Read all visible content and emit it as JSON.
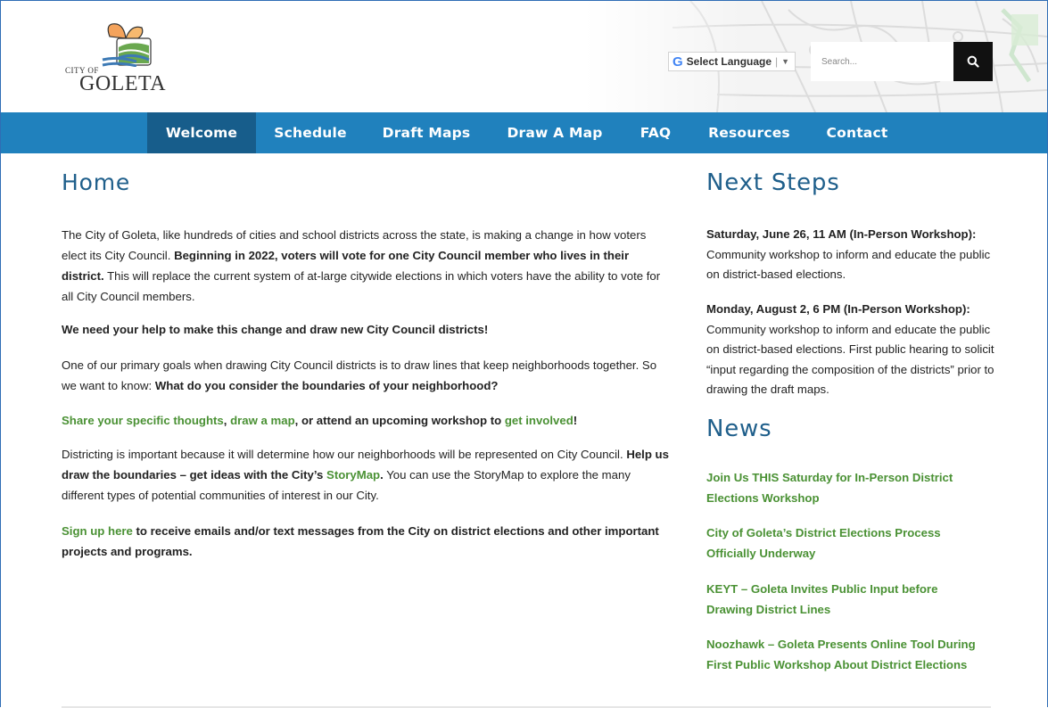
{
  "header": {
    "logo_city_of": "CITY OF",
    "logo_name": "GOLETA",
    "translate_label": "Select Language",
    "translate_g": "G",
    "translate_arrow": "▼",
    "search_placeholder": "Search...",
    "search_icon": "search-icon"
  },
  "nav": {
    "items": [
      {
        "label": "Welcome",
        "active": true
      },
      {
        "label": "Schedule"
      },
      {
        "label": "Draft Maps"
      },
      {
        "label": "Draw A Map"
      },
      {
        "label": "FAQ"
      },
      {
        "label": "Resources"
      },
      {
        "label": "Contact"
      }
    ]
  },
  "main": {
    "title": "Home",
    "p1_a": "The City of Goleta, like hundreds of cities and school districts across the state, is making a change in how voters elect its City Council. ",
    "p1_b": "Beginning in 2022, voters will vote for one City Council member who lives in their district.",
    "p1_c": " This will replace the current system of at-large citywide elections in which voters have the ability to vote for all City Council members.",
    "p2": "We need your help to make this change and draw new City Council districts!",
    "p3_a": "One of our primary goals when drawing City Council districts is to draw lines that keep neighborhoods together. So we want to know: ",
    "p3_b": "What do you consider the boundaries of your neighborhood?",
    "p4_link1": "Share your specific thoughts",
    "p4_sep1": ", ",
    "p4_link2": "draw a map",
    "p4_mid": ", or attend an upcoming workshop to ",
    "p4_link3": "get involved",
    "p4_end": "!",
    "p5_a": "Districting is important because it will determine how our neighborhoods will be represented on City Council. ",
    "p5_b": "Help us draw the boundaries – get ideas with the City’s ",
    "p5_link": "StoryMap",
    "p5_c": ".",
    "p5_d": " You can use the StoryMap to explore the many different types of potential communities of interest in our City.",
    "p6_link": "Sign up here",
    "p6_rest": " to receive emails and/or text messages from the City on district elections and other important projects and programs."
  },
  "sidebar": {
    "next_steps_title": "Next Steps",
    "events": [
      {
        "title": "Saturday, June 26, 11 AM (In-Person Workshop):",
        "desc": "Community workshop to inform and educate the public on district-based elections."
      },
      {
        "title": "Monday, August 2, 6 PM (In-Person Workshop):",
        "desc": "Community workshop to inform and educate the public on district-based elections. First public hearing to solicit “input regarding the composition of the districts” prior to drawing the draft maps."
      }
    ],
    "news_title": "News",
    "news": [
      "Join Us THIS Saturday for In-Person District Elections Workshop",
      "City of Goleta’s District Elections Process Officially Underway",
      "KEYT – Goleta Invites Public Input before Drawing District Lines",
      "Noozhawk – Goleta Presents Online Tool During First Public Workshop About District Elections"
    ]
  },
  "colors": {
    "nav_bg": "#2081bd",
    "nav_active": "#175d8b",
    "heading": "#1f5f8b",
    "link_green": "#4a9134"
  }
}
